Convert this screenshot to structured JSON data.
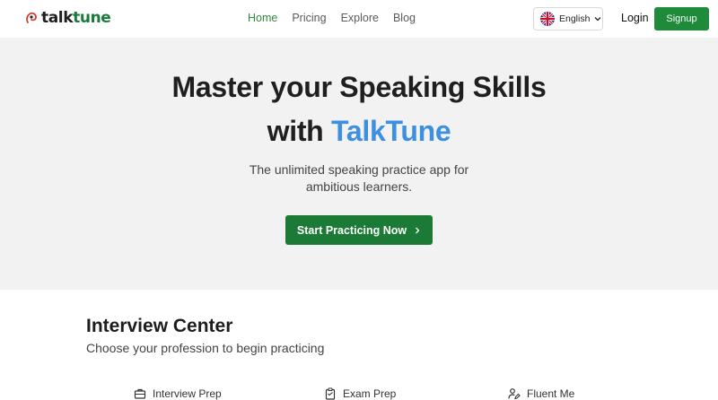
{
  "brand": {
    "talk": "talk",
    "tune": "tune"
  },
  "nav": {
    "links": [
      {
        "label": "Home",
        "active": true
      },
      {
        "label": "Pricing",
        "active": false
      },
      {
        "label": "Explore",
        "active": false
      },
      {
        "label": "Blog",
        "active": false
      }
    ],
    "language": "English",
    "login": "Login",
    "signup": "Signup"
  },
  "hero": {
    "line1": "Master your Speaking Skills",
    "line2_prefix": "with ",
    "line2_brand": "TalkTune",
    "subtitle": "The unlimited speaking practice app for ambitious learners.",
    "cta": "Start Practicing Now"
  },
  "section": {
    "title": "Interview Center",
    "subtitle": "Choose your profession to begin practicing",
    "categories": [
      {
        "label": "Interview Prep",
        "icon": "briefcase-icon"
      },
      {
        "label": "Exam Prep",
        "icon": "clipboard-icon"
      },
      {
        "label": "Fluent Me",
        "icon": "person-edit-icon"
      }
    ]
  },
  "colors": {
    "accent": "#1e8a3a",
    "brand_blue": "#3d8fe0",
    "hero_bg": "#f2f2f2"
  }
}
